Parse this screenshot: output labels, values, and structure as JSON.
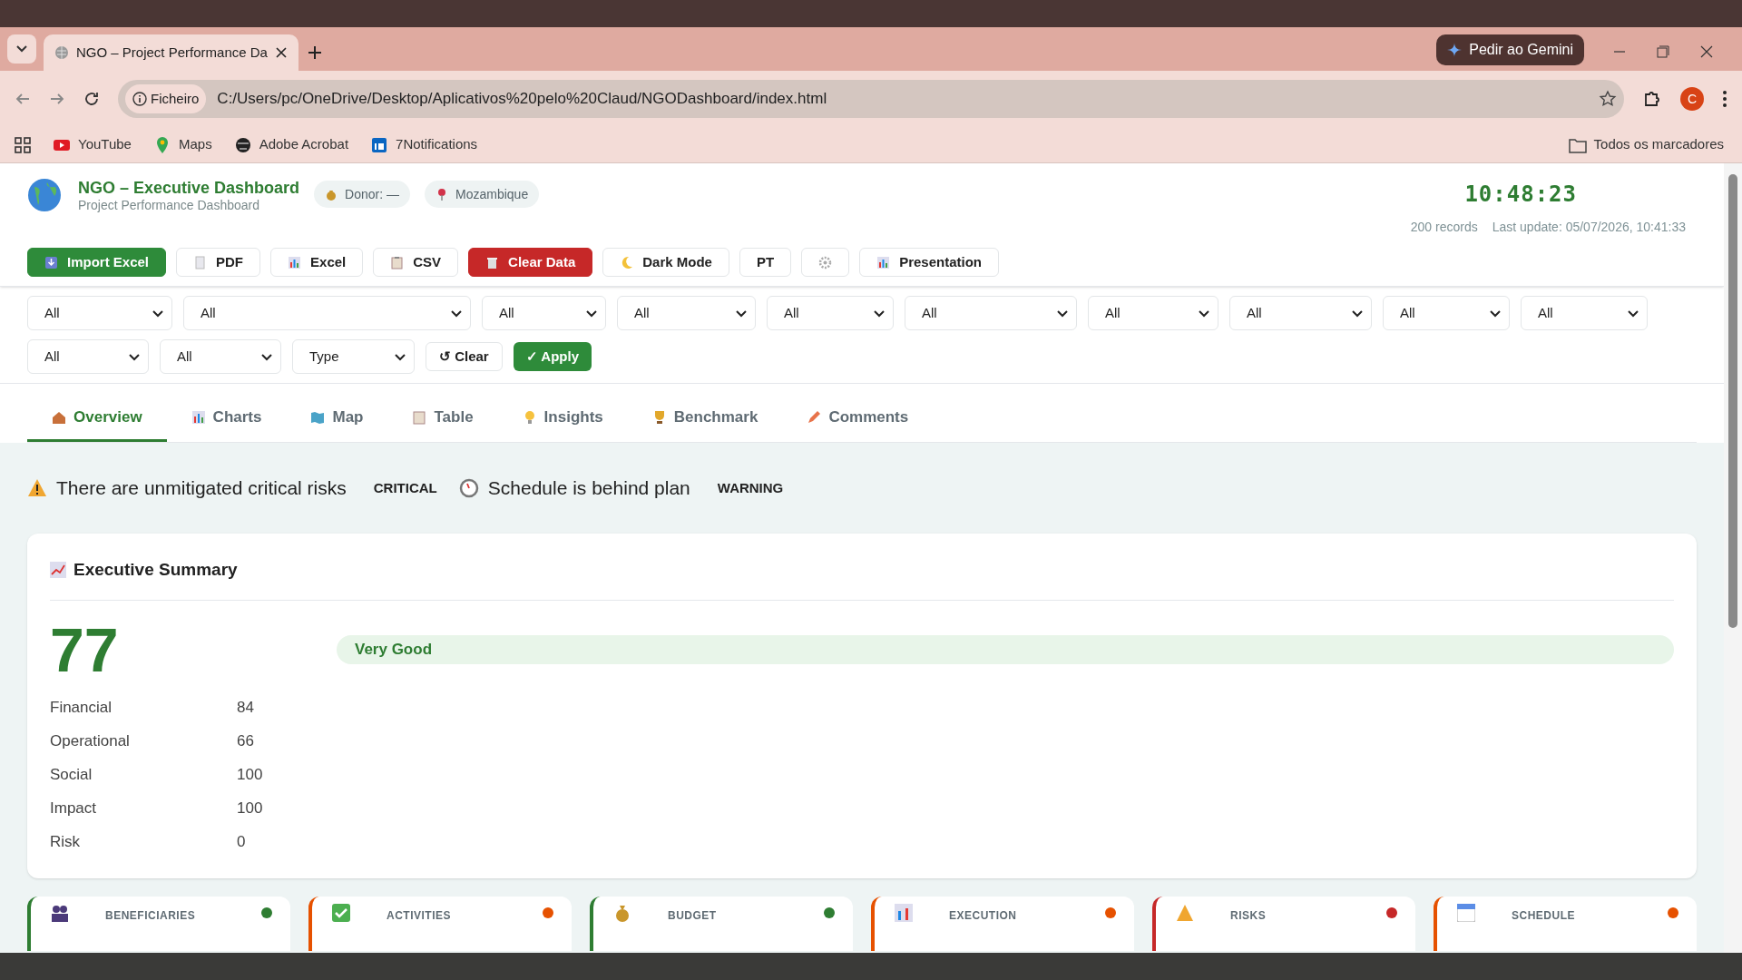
{
  "browser": {
    "tabs": [
      {
        "title": "NGO – Project Performance Da",
        "selected": true
      }
    ],
    "address": {
      "scheme": "Ficheiro",
      "url": "C:/Users/pc/OneDrive/Desktop/Aplicativos%20pelo%20Claud/NGODashboard/index.html"
    },
    "gemini": "Pedir ao Gemini",
    "profile": "C",
    "bookmarks": [
      "YouTube",
      "Maps",
      "Adobe Acrobat",
      "7Notifications"
    ],
    "all_bookmarks": "Todos os marcadores"
  },
  "header": {
    "title": "NGO – Executive Dashboard",
    "subtitle": "Project Performance Dashboard",
    "chips": [
      "Donor: —",
      "Mozambique"
    ],
    "clock": "10:48:23",
    "records": "200 records",
    "last_update": "Last update: 05/07/2026, 10:41:33"
  },
  "toolbar": [
    {
      "kind": "primary",
      "label": "Import Excel"
    },
    {
      "kind": "plain",
      "label": "PDF"
    },
    {
      "kind": "plain",
      "label": "Excel"
    },
    {
      "kind": "plain",
      "label": "CSV"
    },
    {
      "kind": "danger",
      "label": "Clear Data"
    },
    {
      "kind": "plain",
      "label": "Dark Mode"
    },
    {
      "kind": "plain",
      "label": "PT"
    },
    {
      "kind": "plain"
    },
    {
      "kind": "plain",
      "label": "Presentation"
    }
  ],
  "filters": {
    "row_1": [
      "All",
      "All",
      "All",
      "All",
      "All",
      "All",
      "All",
      "All",
      "All",
      "All"
    ],
    "row_2": [
      "All",
      "All",
      "Type"
    ],
    "clear": "↺ Clear",
    "apply": "✓ Apply"
  },
  "tabs": [
    {
      "label": "Overview",
      "selected": true
    },
    {
      "label": "Charts",
      "selected": false
    },
    {
      "label": "Map",
      "selected": false
    },
    {
      "label": "Table",
      "selected": false
    },
    {
      "label": "Insights",
      "selected": false
    },
    {
      "label": "Benchmark",
      "selected": false
    },
    {
      "label": "Comments",
      "selected": false
    }
  ],
  "alerts": [
    {
      "kind": "risk",
      "text": "There are unmitigated critical risks",
      "badge": "CRITICAL"
    },
    {
      "kind": "schedule",
      "text": "Schedule is behind plan",
      "badge": "WARNING"
    }
  ],
  "summary": {
    "title": "Executive Summary",
    "score": "77",
    "rating": "Very Good",
    "metrics": [
      {
        "label": "Financial",
        "value": "84"
      },
      {
        "label": "Operational",
        "value": "66"
      },
      {
        "label": "Social",
        "value": "100"
      },
      {
        "label": "Impact",
        "value": "100"
      },
      {
        "label": "Risk",
        "value": "0"
      }
    ]
  },
  "cards": [
    {
      "label": "BENEFICIARIES",
      "color": "#2e7d32"
    },
    {
      "label": "ACTIVITIES",
      "color": "#e65100"
    },
    {
      "label": "BUDGET",
      "color": "#2e7d32"
    },
    {
      "label": "EXECUTION",
      "color": "#e65100"
    },
    {
      "label": "RISKS",
      "color": "#c62828"
    },
    {
      "label": "SCHEDULE",
      "color": "#e65100"
    }
  ]
}
